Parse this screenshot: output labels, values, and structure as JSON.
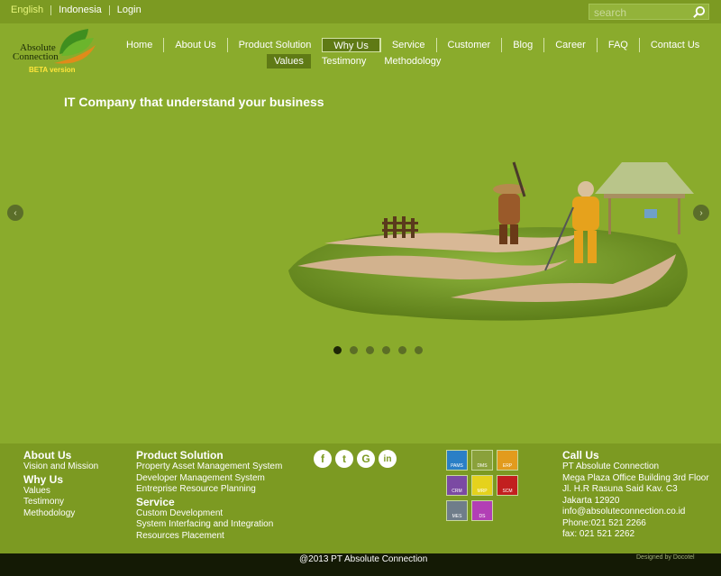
{
  "topbar": {
    "languages": [
      "English",
      "Indonesia",
      "Login"
    ],
    "search_placeholder": "search"
  },
  "logo": {
    "line1": "Absolute",
    "line2": "Connection",
    "beta": "BETA version"
  },
  "nav": {
    "items": [
      "Home",
      "About Us",
      "Product Solution",
      "Why Us",
      "Service",
      "Customer",
      "Blog",
      "Career",
      "FAQ",
      "Contact Us"
    ],
    "active": "Why Us",
    "sub_items": [
      "Values",
      "Testimony",
      "Methodology"
    ],
    "active_sub": "Values"
  },
  "hero": {
    "tagline": "IT Company that understand your business",
    "slide_count": 6,
    "active_slide": 1,
    "prev_arrow": "‹",
    "next_arrow": "›"
  },
  "footer": {
    "about": {
      "title": "About Us",
      "items": [
        "Vision and Mission"
      ]
    },
    "whyus": {
      "title": "Why Us",
      "items": [
        "Values",
        "Testimony",
        "Methodology"
      ]
    },
    "product": {
      "title": "Product Solution",
      "items": [
        "Property Asset Management System",
        "Developer Management System",
        "Entreprise Resource Planning"
      ]
    },
    "service": {
      "title": "Service",
      "items": [
        "Custom Development",
        "System Interfacing and Integration",
        "Resources Placement"
      ]
    },
    "socials": [
      {
        "icon": "facebook-icon",
        "glyph": "f"
      },
      {
        "icon": "twitter-icon",
        "glyph": "t"
      },
      {
        "icon": "google-plus-icon",
        "glyph": "G"
      },
      {
        "icon": "linkedin-icon",
        "glyph": "in"
      }
    ],
    "apps": [
      {
        "label": "PAMS",
        "color": "#2a7fc6"
      },
      {
        "label": "DMS",
        "color": "#8aa13b"
      },
      {
        "label": "ERP",
        "color": "#e29b1d"
      },
      {
        "label": "CRM",
        "color": "#7b4aa3"
      },
      {
        "label": "MRP",
        "color": "#e5d21c"
      },
      {
        "label": "SCM",
        "color": "#c21f1f"
      },
      {
        "label": "MES",
        "color": "#6f7d8a"
      },
      {
        "label": "DS",
        "color": "#b23fb5"
      }
    ],
    "contact": {
      "title": "Call Us",
      "lines": [
        "PT Absolute Connection",
        "Mega Plaza Office Building 3rd Floor",
        "Jl. H.R Rasuna Said Kav. C3",
        "Jakarta 12920",
        "info@absoluteconnection.co.id",
        "Phone:021 521 2266",
        "fax: 021 521 2262"
      ]
    }
  },
  "bottom": {
    "copyright": "@2013 PT Absolute Connection",
    "designed": "Designed by Docotel"
  },
  "colors": {
    "background": "#8aab2c",
    "bar": "#7c9a22",
    "active_nav": "#5f7a15",
    "accent_lang": "#e7f57a"
  }
}
